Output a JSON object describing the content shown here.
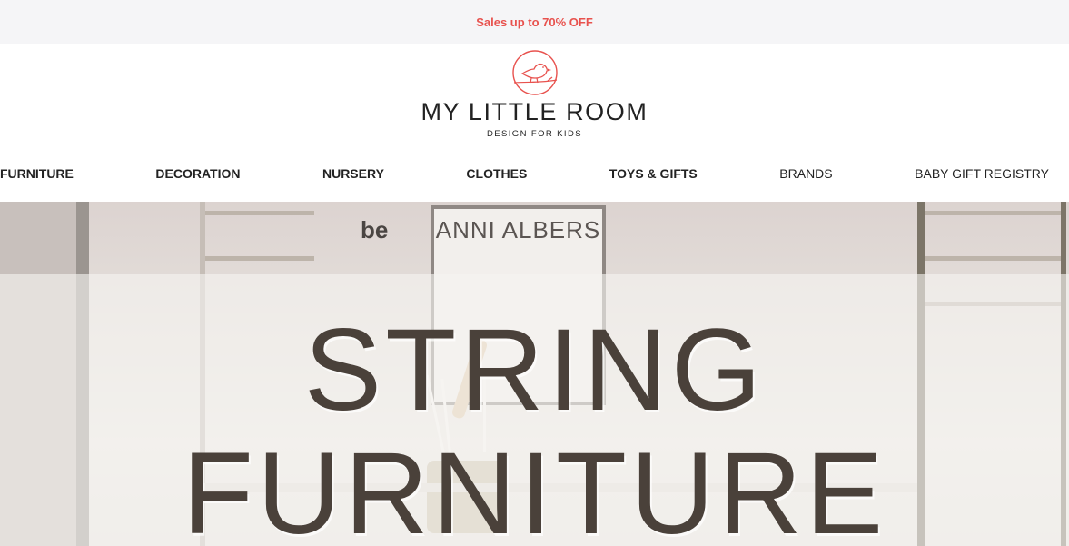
{
  "promo": {
    "text": "Sales up to 70% OFF"
  },
  "brand": {
    "name": "MY LITTLE ROOM",
    "tagline": "DESIGN FOR KIDS",
    "accent": "#e8524e"
  },
  "nav": {
    "items": [
      {
        "label": "FURNITURE"
      },
      {
        "label": "DECORATION"
      },
      {
        "label": "NURSERY"
      },
      {
        "label": "CLOTHES"
      },
      {
        "label": "TOYS & GIFTS"
      },
      {
        "label": "BRANDS"
      },
      {
        "label": "BABY GIFT REGISTRY"
      }
    ]
  },
  "hero": {
    "headline_line1": "STRING",
    "headline_line2": "FURNITURE",
    "poster_text": "ANNI ALBERS",
    "side_text": "be"
  }
}
